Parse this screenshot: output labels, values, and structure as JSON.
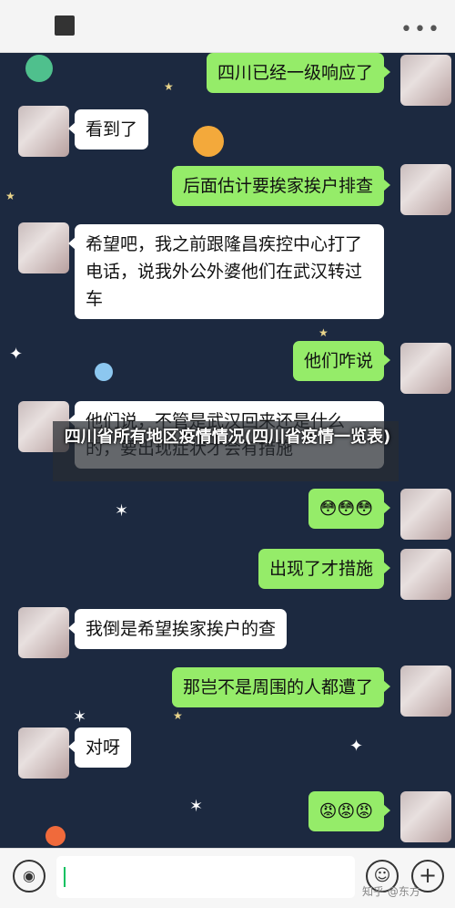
{
  "chat": {
    "messages": [
      {
        "side": "out",
        "text": "四川已经一级响应了"
      },
      {
        "side": "in",
        "text": "看到了"
      },
      {
        "side": "out",
        "text": "后面估计要挨家挨户排查"
      },
      {
        "side": "in",
        "text": "希望吧，我之前跟隆昌疾控中心打了电话，说我外公外婆他们在武汉转过车"
      },
      {
        "side": "out",
        "text": "他们咋说"
      },
      {
        "side": "in",
        "text": "他们说，不管是武汉回来还是什么的，要出现症状才会有措施"
      },
      {
        "side": "out",
        "text": "😳😳😳"
      },
      {
        "side": "out",
        "text": "出现了才措施"
      },
      {
        "side": "in",
        "text": "我倒是希望挨家挨户的查"
      },
      {
        "side": "out",
        "text": "那岂不是周围的人都遭了"
      },
      {
        "side": "in",
        "text": "对呀"
      },
      {
        "side": "out",
        "text": "😡😡😡"
      }
    ]
  },
  "overlay": {
    "title": "四川省所有地区疫情情况(四川省疫情一览表)"
  },
  "icons": {
    "back": "back-icon",
    "more": "more-icon",
    "voice": "voice-icon",
    "emoji": "emoji-icon",
    "plus": "plus-icon"
  },
  "watermark": "知乎 @东方"
}
